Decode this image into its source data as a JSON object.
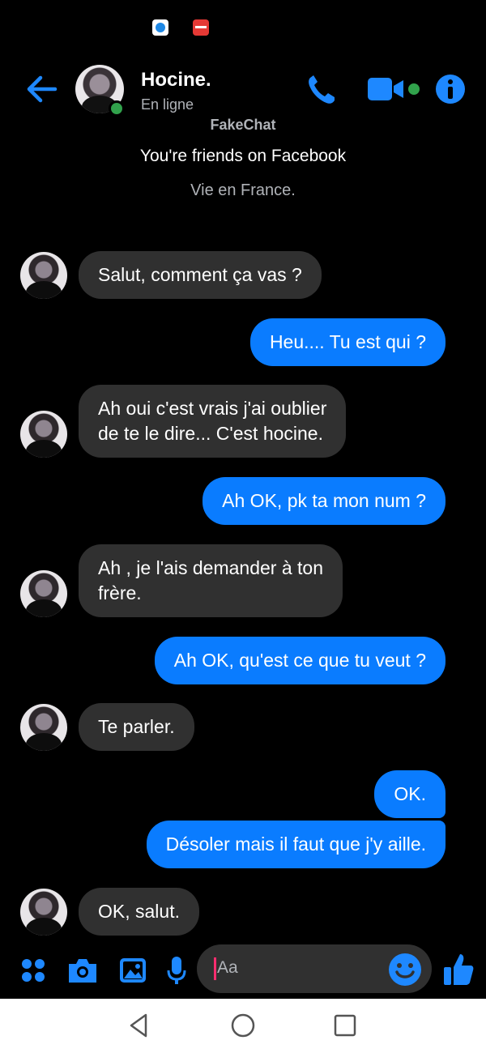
{
  "status_bar": {
    "icons": [
      "app-notification-icon",
      "manga-app-notification-icon"
    ]
  },
  "header": {
    "name": "Hocine.",
    "status": "En ligne",
    "back_icon": "arrow-left-icon",
    "call_icon": "phone-icon",
    "video_icon": "video-camera-icon",
    "info_icon": "info-icon"
  },
  "intro": {
    "watermark": "FakeChat",
    "friends": "You're friends on Facebook",
    "location": "Vie en France."
  },
  "messages": [
    {
      "dir": "in",
      "text": "Salut, comment ça vas ?"
    },
    {
      "dir": "out",
      "text": "Heu.... Tu est qui ?"
    },
    {
      "dir": "in",
      "line1": "Ah oui c'est vrais j'ai oublier",
      "line2": "de te le dire... C'est hocine."
    },
    {
      "dir": "out",
      "text": "Ah OK, pk ta mon num ?"
    },
    {
      "dir": "in",
      "line1": "Ah , je l'ais demander à ton",
      "line2": "frère."
    },
    {
      "dir": "out",
      "text": "Ah OK, qu'est ce que tu veut ?"
    },
    {
      "dir": "in",
      "text": "Te parler."
    },
    {
      "dir": "out",
      "text": "OK."
    },
    {
      "dir": "out",
      "text": "Désoler mais il faut que j'y aille."
    },
    {
      "dir": "in",
      "text": "OK, salut."
    }
  ],
  "composer": {
    "placeholder": "Aa",
    "icons": [
      "apps-grid-icon",
      "camera-icon",
      "gallery-icon",
      "microphone-icon",
      "emoji-icon",
      "thumbs-up-icon"
    ]
  },
  "colors": {
    "accent": "#0a7cff",
    "incoming_bubble": "#303030",
    "online": "#31a24c",
    "background": "#000000"
  }
}
